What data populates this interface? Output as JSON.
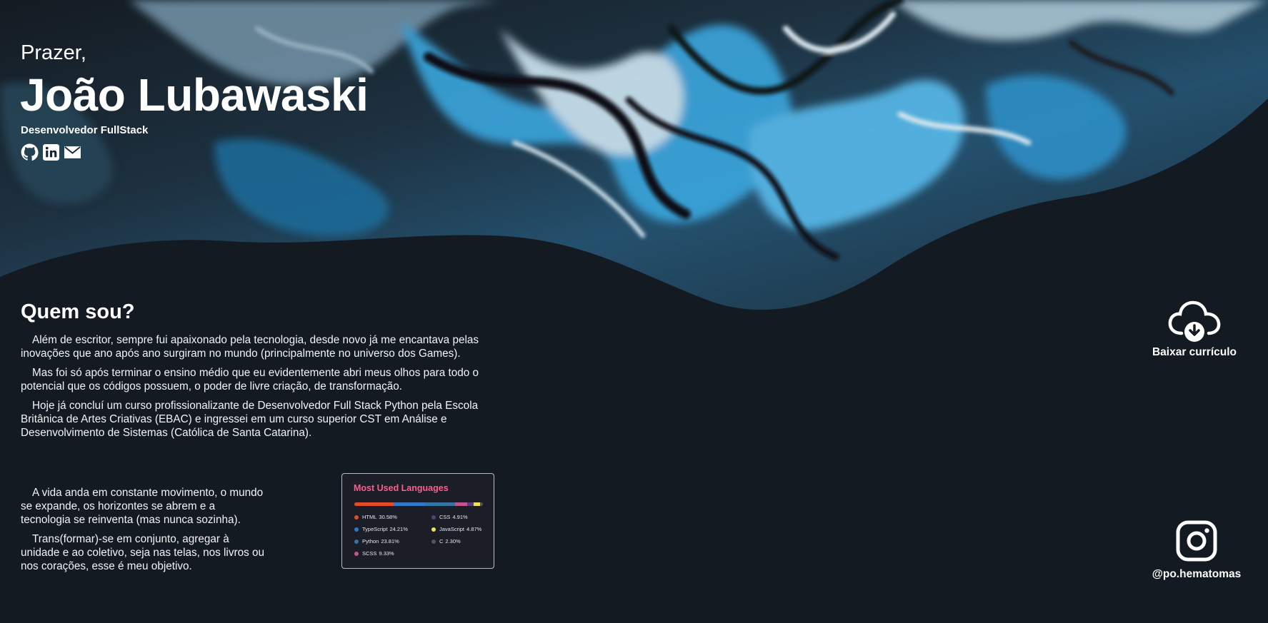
{
  "hero": {
    "greeting": "Prazer,",
    "name": "João Lubawaski",
    "role": "Desenvolvedor FullStack",
    "social": [
      {
        "icon": "github-icon"
      },
      {
        "icon": "linkedin-icon"
      },
      {
        "icon": "mail-icon"
      }
    ]
  },
  "about": {
    "title": "Quem sou?",
    "paragraphs": [
      "Além de escritor, sempre fui apaixonado pela tecnologia, desde novo já me encantava pelas inovações que ano após ano surgiram no mundo (principalmente no universo dos Games).",
      "Mas foi só após terminar o ensino médio que eu evidentemente abri meus olhos para todo o potencial que os códigos possuem, o poder de livre criação, de transformação.",
      "Hoje já concluí um curso profissionalizante de Desenvolvedor Full Stack Python pela Escola Britânica de Artes Criativas (EBAC) e ingressei em um curso superior CST em Análise e Desenvolvimento de Sistemas (Católica de Santa Catarina)."
    ],
    "closing": [
      "A vida anda em constante movimento, o mundo se expande, os horizontes se abrem e a tecnologia se reinventa (mas nunca sozinha).",
      "Trans(formar)-se em conjunto, agregar à unidade e ao coletivo, seja nas telas, nos livros ou nos corações, esse é meu objetivo."
    ]
  },
  "stats_card": {
    "title": "Most Used Languages",
    "languages": [
      {
        "name": "HTML",
        "percent": "30.58%",
        "value": 30.58,
        "color": "#e34c26"
      },
      {
        "name": "TypeScript",
        "percent": "24.21%",
        "value": 24.21,
        "color": "#3178c6"
      },
      {
        "name": "Python",
        "percent": "23.81%",
        "value": 23.81,
        "color": "#3572a5"
      },
      {
        "name": "SCSS",
        "percent": "9.33%",
        "value": 9.33,
        "color": "#c6538c"
      },
      {
        "name": "CSS",
        "percent": "4.91%",
        "value": 4.91,
        "color": "#563d7c"
      },
      {
        "name": "JavaScript",
        "percent": "4.87%",
        "value": 4.87,
        "color": "#f1e05a"
      },
      {
        "name": "C",
        "percent": "2.30%",
        "value": 2.3,
        "color": "#555555"
      }
    ]
  },
  "download": {
    "label": "Baixar currículo",
    "icon": "cloud-download-icon"
  },
  "instagram": {
    "handle": "@po.hematomas",
    "icon": "instagram-icon"
  },
  "colors": {
    "background": "#131a21",
    "text": "#ffffff",
    "card_title": "#fd5e8d",
    "card_bg": "#1b1d27"
  }
}
